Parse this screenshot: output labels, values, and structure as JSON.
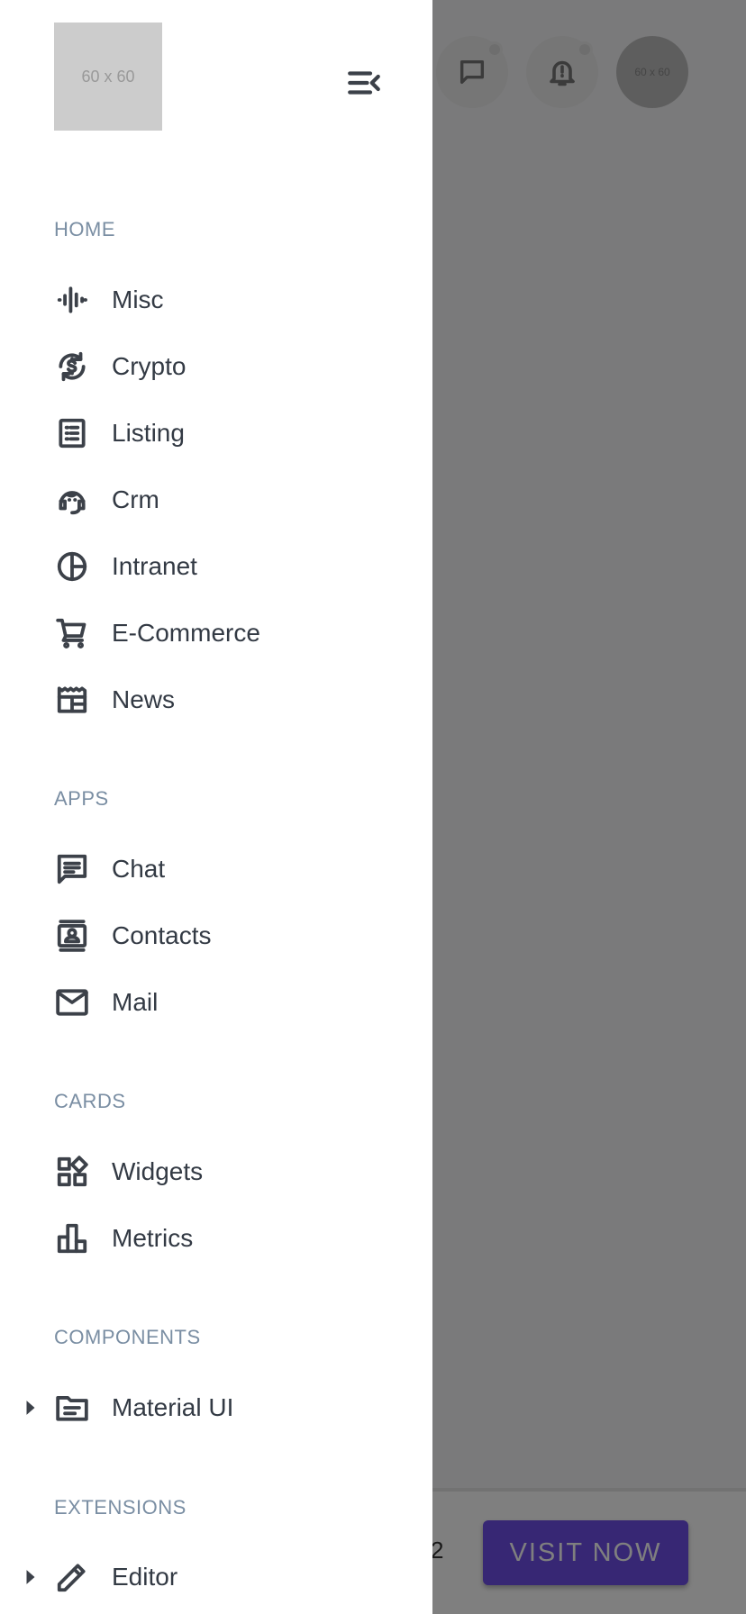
{
  "header": {
    "logo_text": "60 x 60",
    "avatar_text": "60 x 60"
  },
  "sections": {
    "home": "HOME",
    "apps": "APPS",
    "cards": "CARDS",
    "components": "COMPONENTS",
    "extensions": "EXTENSIONS"
  },
  "menu": {
    "misc": "Misc",
    "crypto": "Crypto",
    "listing": "Listing",
    "crm": "Crm",
    "intranet": "Intranet",
    "ecommerce": "E-Commerce",
    "news": "News",
    "chat": "Chat",
    "contacts": "Contacts",
    "mail": "Mail",
    "widgets": "Widgets",
    "metrics": "Metrics",
    "material_ui": "Material UI",
    "editor": "Editor"
  },
  "background": {
    "partial_number": "2",
    "visit_button": "VISIT NOW"
  },
  "colors": {
    "accent": "#6f4ee8",
    "section_label": "#7a8ea3",
    "icon": "#3c4149"
  }
}
